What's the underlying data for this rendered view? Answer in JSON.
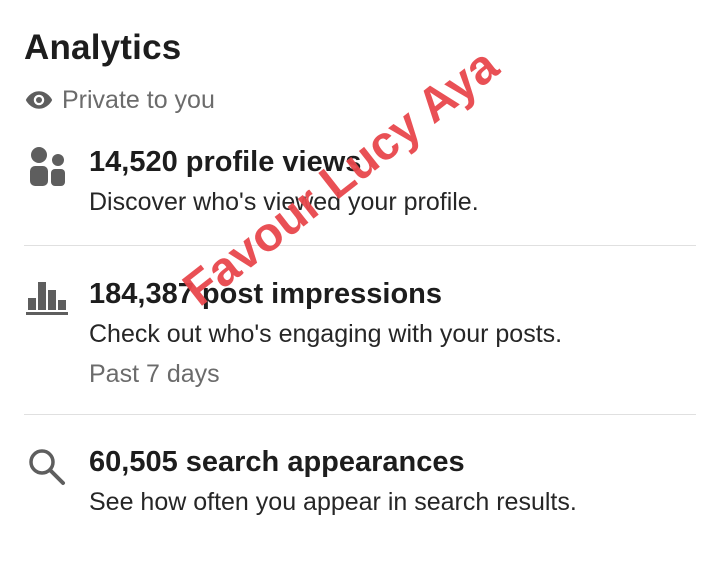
{
  "header": {
    "title": "Analytics",
    "privacy_label": "Private to you",
    "privacy_icon": "eye-icon"
  },
  "items": [
    {
      "icon": "people-icon",
      "heading": "14,520 profile views",
      "description": "Discover who's viewed your profile."
    },
    {
      "icon": "bar-chart-icon",
      "heading": "184,387 post impressions",
      "description": "Check out who's engaging with your posts.",
      "meta": "Past 7 days"
    },
    {
      "icon": "search-icon",
      "heading": "60,505 search appearances",
      "description": "See how often you appear in search results."
    }
  ],
  "watermark": "Favour Lucy Aya",
  "colors": {
    "text_primary": "#1d1d1d",
    "text_secondary": "#6b6b6b",
    "icon": "#5e5e5e",
    "divider": "#e0e0e0",
    "watermark": "#e8474c"
  }
}
